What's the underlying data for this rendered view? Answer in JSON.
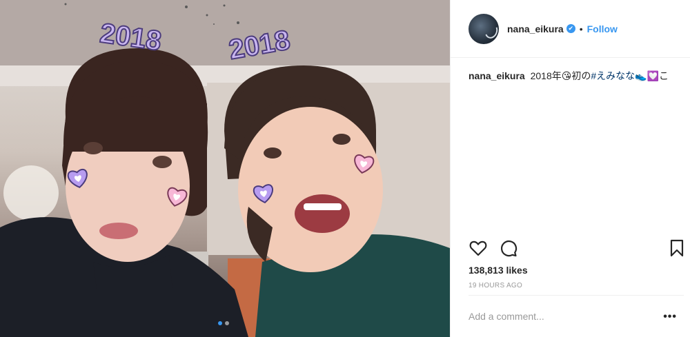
{
  "post": {
    "username": "nana_eikura",
    "verified_mark": "✔",
    "separator": "•",
    "follow_label": "Follow",
    "caption_user": "nana_eikura",
    "caption_text": "2018年",
    "caption_emoji_1": "😘",
    "caption_text_2": "初の",
    "caption_hashtag": "#えみなな",
    "caption_emoji_2": "👟💟",
    "caption_tail": "こ",
    "likes": "138,813 likes",
    "time": "19 HOURS AGO",
    "comment_placeholder": "Add a comment...",
    "more_label": "•••"
  },
  "photo": {
    "sticker_text_left": "2018",
    "sticker_text_right": "2018",
    "carousel": {
      "count": 2,
      "active": 0
    }
  },
  "icons": {
    "like": "heart-icon",
    "comment": "comment-icon",
    "save": "bookmark-icon",
    "verified": "verified-badge-icon"
  },
  "colors": {
    "accent": "#3897f0",
    "hashtag": "#003569",
    "muted": "#999999",
    "border": "#efefef",
    "sticker_purple": "#c9b6f0",
    "heart_pink": "#f7b7d6",
    "heart_purple": "#b79cf0"
  }
}
